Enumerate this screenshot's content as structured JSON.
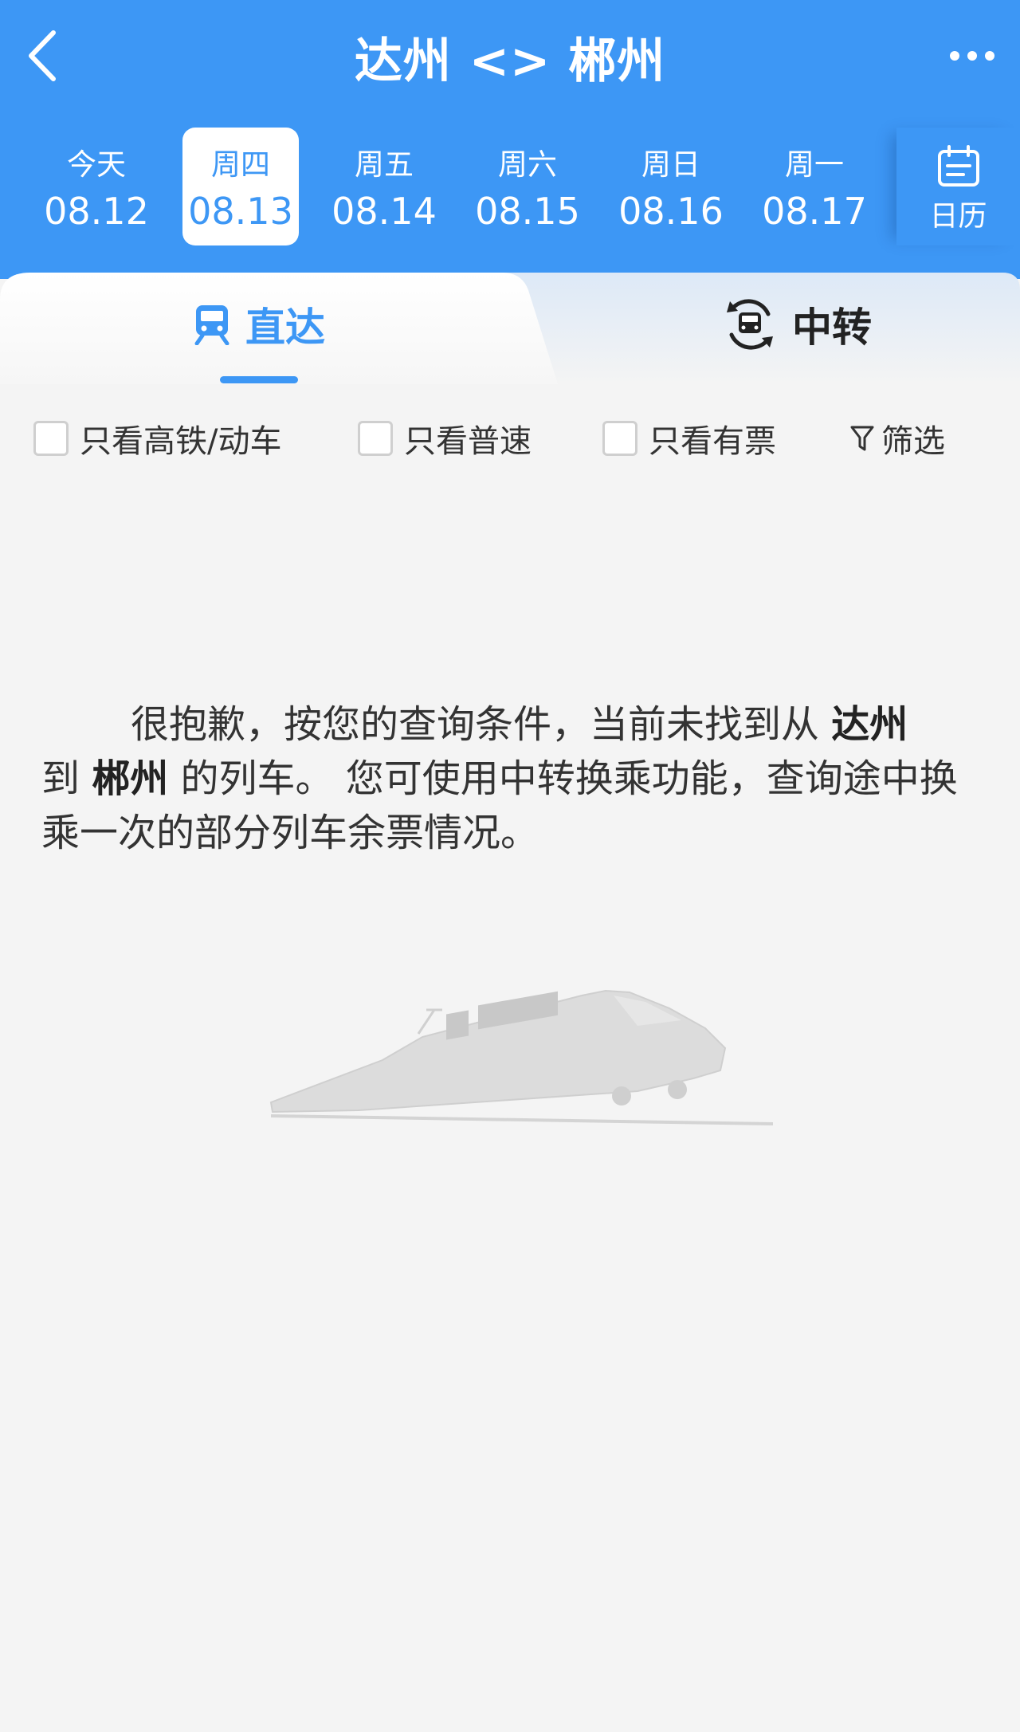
{
  "header": {
    "title": "达州 <> 郴州",
    "back_icon": "chevron-left-icon",
    "more_icon": "more-dots-icon",
    "color": "#3d97f5"
  },
  "dates": [
    {
      "week": "今天",
      "day": "08.12",
      "selected": false
    },
    {
      "week": "周四",
      "day": "08.13",
      "selected": true
    },
    {
      "week": "周五",
      "day": "08.14",
      "selected": false
    },
    {
      "week": "周六",
      "day": "08.15",
      "selected": false
    },
    {
      "week": "周日",
      "day": "08.16",
      "selected": false
    },
    {
      "week": "周一",
      "day": "08.17",
      "selected": false
    }
  ],
  "calendar": {
    "label": "日历",
    "icon": "calendar-icon"
  },
  "tabs": {
    "direct": {
      "label": "直达",
      "icon": "train-icon",
      "active": true
    },
    "transfer": {
      "label": "中转",
      "icon": "transfer-train-icon",
      "active": false
    }
  },
  "filters": {
    "high_speed": "只看高铁/动车",
    "normal": "只看普速",
    "available": "只看有票",
    "screen": "筛选",
    "screen_icon": "funnel-icon"
  },
  "message": {
    "part1": "很抱歉，按您的查询条件，当前未找到从 ",
    "from": "达州",
    "part2": "到 ",
    "to": "郴州",
    "part3": " 的列车。 您可使用中转换乘功能，查询途中换乘一次的部分列车余票情况。"
  },
  "illustration": {
    "icon": "train-illustration"
  }
}
